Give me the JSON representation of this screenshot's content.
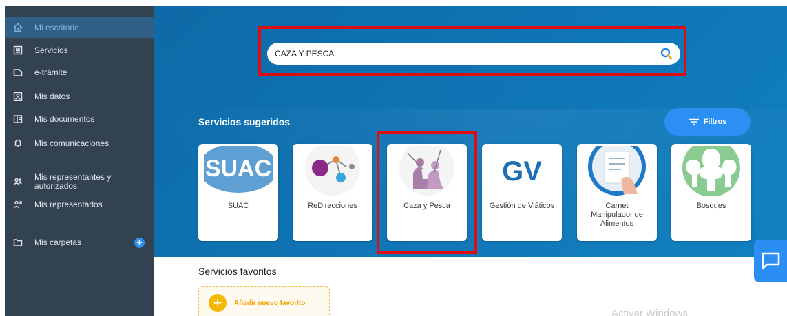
{
  "sidebar": {
    "items": [
      {
        "label": "Mi escritorio",
        "icon": "home-icon"
      },
      {
        "label": "Servicios",
        "icon": "services-icon"
      },
      {
        "label": "e-trámite",
        "icon": "etramite-icon"
      },
      {
        "label": "Mis datos",
        "icon": "id-card-icon"
      },
      {
        "label": "Mis documentos",
        "icon": "documents-icon"
      },
      {
        "label": "Mis comunicaciones",
        "icon": "bell-icon"
      },
      {
        "label": "Mis representantes y autorizados",
        "icon": "people-icon"
      },
      {
        "label": "Mis representados",
        "icon": "person-voice-icon"
      },
      {
        "label": "Mis carpetas",
        "icon": "folder-icon"
      }
    ]
  },
  "search": {
    "value": "CAZA Y PESCA"
  },
  "suggested": {
    "title": "Servicios sugeridos",
    "filter_label": "Filtros",
    "cards": [
      {
        "label": "SUAC"
      },
      {
        "label": "ReDirecciones"
      },
      {
        "label": "Caza y Pesca"
      },
      {
        "label": "Gestión de Viáticos"
      },
      {
        "label": "Carnet Manipulador de Alimentos"
      },
      {
        "label": "Bosques"
      }
    ]
  },
  "favorites": {
    "title": "Servicios favoritos",
    "add_label": "Añadir nuevo favorito"
  },
  "windows_watermark": "Activar Windows",
  "colors": {
    "accent": "#2b8ff3",
    "banner": "#0f76b6",
    "sidebar": "#334250",
    "highlight": "#e00c12"
  }
}
